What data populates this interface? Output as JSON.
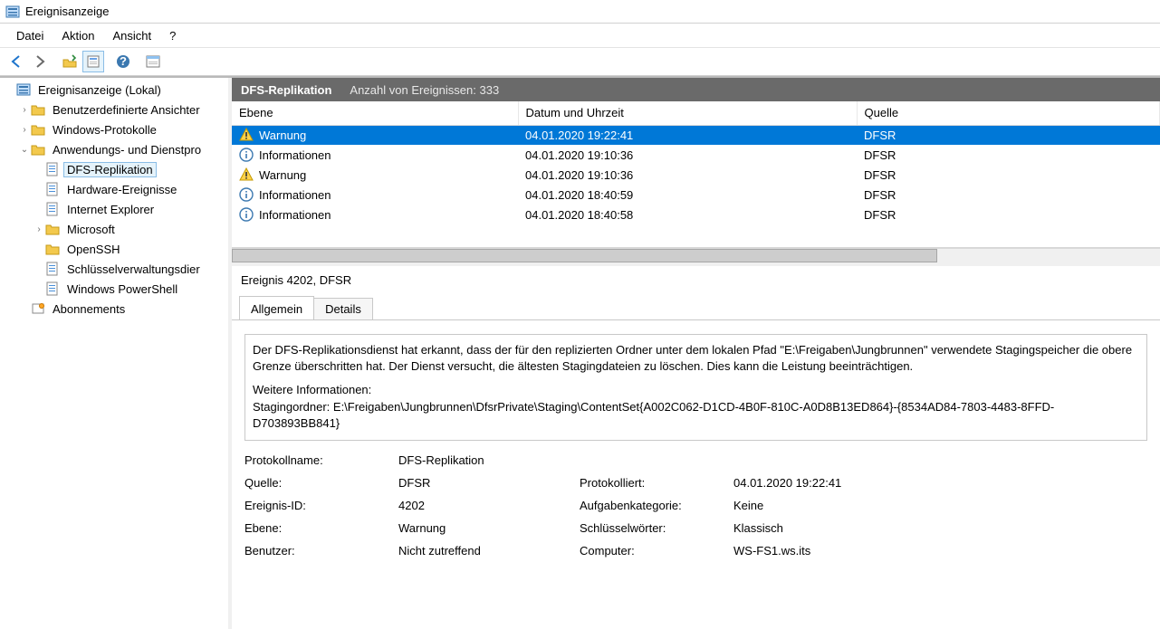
{
  "window": {
    "title": "Ereignisanzeige"
  },
  "menu": {
    "file": "Datei",
    "action": "Aktion",
    "view": "Ansicht",
    "help": "?"
  },
  "tree": {
    "root": "Ereignisanzeige (Lokal)",
    "custom_views": "Benutzerdefinierte Ansichter",
    "windows_logs": "Windows-Protokolle",
    "app_service_logs": "Anwendungs- und Dienstpro",
    "dfs_replication": "DFS-Replikation",
    "hardware_events": "Hardware-Ereignisse",
    "internet_explorer": "Internet Explorer",
    "microsoft": "Microsoft",
    "openssh": "OpenSSH",
    "kms": "Schlüsselverwaltungsdier",
    "powershell": "Windows PowerShell",
    "subscriptions": "Abonnements"
  },
  "content": {
    "title": "DFS-Replikation",
    "count_label": "Anzahl von Ereignissen: 333",
    "columns": {
      "level": "Ebene",
      "datetime": "Datum und Uhrzeit",
      "source": "Quelle"
    },
    "rows": [
      {
        "level": "Warnung",
        "icon": "warn",
        "datetime": "04.01.2020 19:22:41",
        "source": "DFSR",
        "selected": true
      },
      {
        "level": "Informationen",
        "icon": "info",
        "datetime": "04.01.2020 19:10:36",
        "source": "DFSR"
      },
      {
        "level": "Warnung",
        "icon": "warn",
        "datetime": "04.01.2020 19:10:36",
        "source": "DFSR"
      },
      {
        "level": "Informationen",
        "icon": "info",
        "datetime": "04.01.2020 18:40:59",
        "source": "DFSR"
      },
      {
        "level": "Informationen",
        "icon": "info",
        "datetime": "04.01.2020 18:40:58",
        "source": "DFSR"
      }
    ]
  },
  "detail": {
    "title": "Ereignis 4202, DFSR",
    "tabs": {
      "general": "Allgemein",
      "details": "Details"
    },
    "message_p1": "Der DFS-Replikationsdienst hat erkannt, dass der für den replizierten Ordner unter dem lokalen Pfad \"E:\\Freigaben\\Jungbrunnen\" verwendete Stagingspeicher die obere Grenze überschritten hat. Der Dienst versucht, die ältesten Stagingdateien zu löschen. Dies kann die Leistung beeinträchtigen.",
    "message_p2": "Weitere Informationen:",
    "message_p3": "Stagingordner: E:\\Freigaben\\Jungbrunnen\\DfsrPrivate\\Staging\\ContentSet{A002C062-D1CD-4B0F-810C-A0D8B13ED864}-{8534AD84-7803-4483-8FFD-D703893BB841}",
    "props": {
      "log_name_lab": "Protokollname:",
      "log_name": "DFS-Replikation",
      "source_lab": "Quelle:",
      "source": "DFSR",
      "logged_lab": "Protokolliert:",
      "logged": "04.01.2020 19:22:41",
      "event_id_lab": "Ereignis-ID:",
      "event_id": "4202",
      "task_cat_lab": "Aufgabenkategorie:",
      "task_cat": "Keine",
      "level_lab": "Ebene:",
      "level": "Warnung",
      "keywords_lab": "Schlüsselwörter:",
      "keywords": "Klassisch",
      "user_lab": "Benutzer:",
      "user": "Nicht zutreffend",
      "computer_lab": "Computer:",
      "computer": "WS-FS1.ws.its"
    }
  }
}
